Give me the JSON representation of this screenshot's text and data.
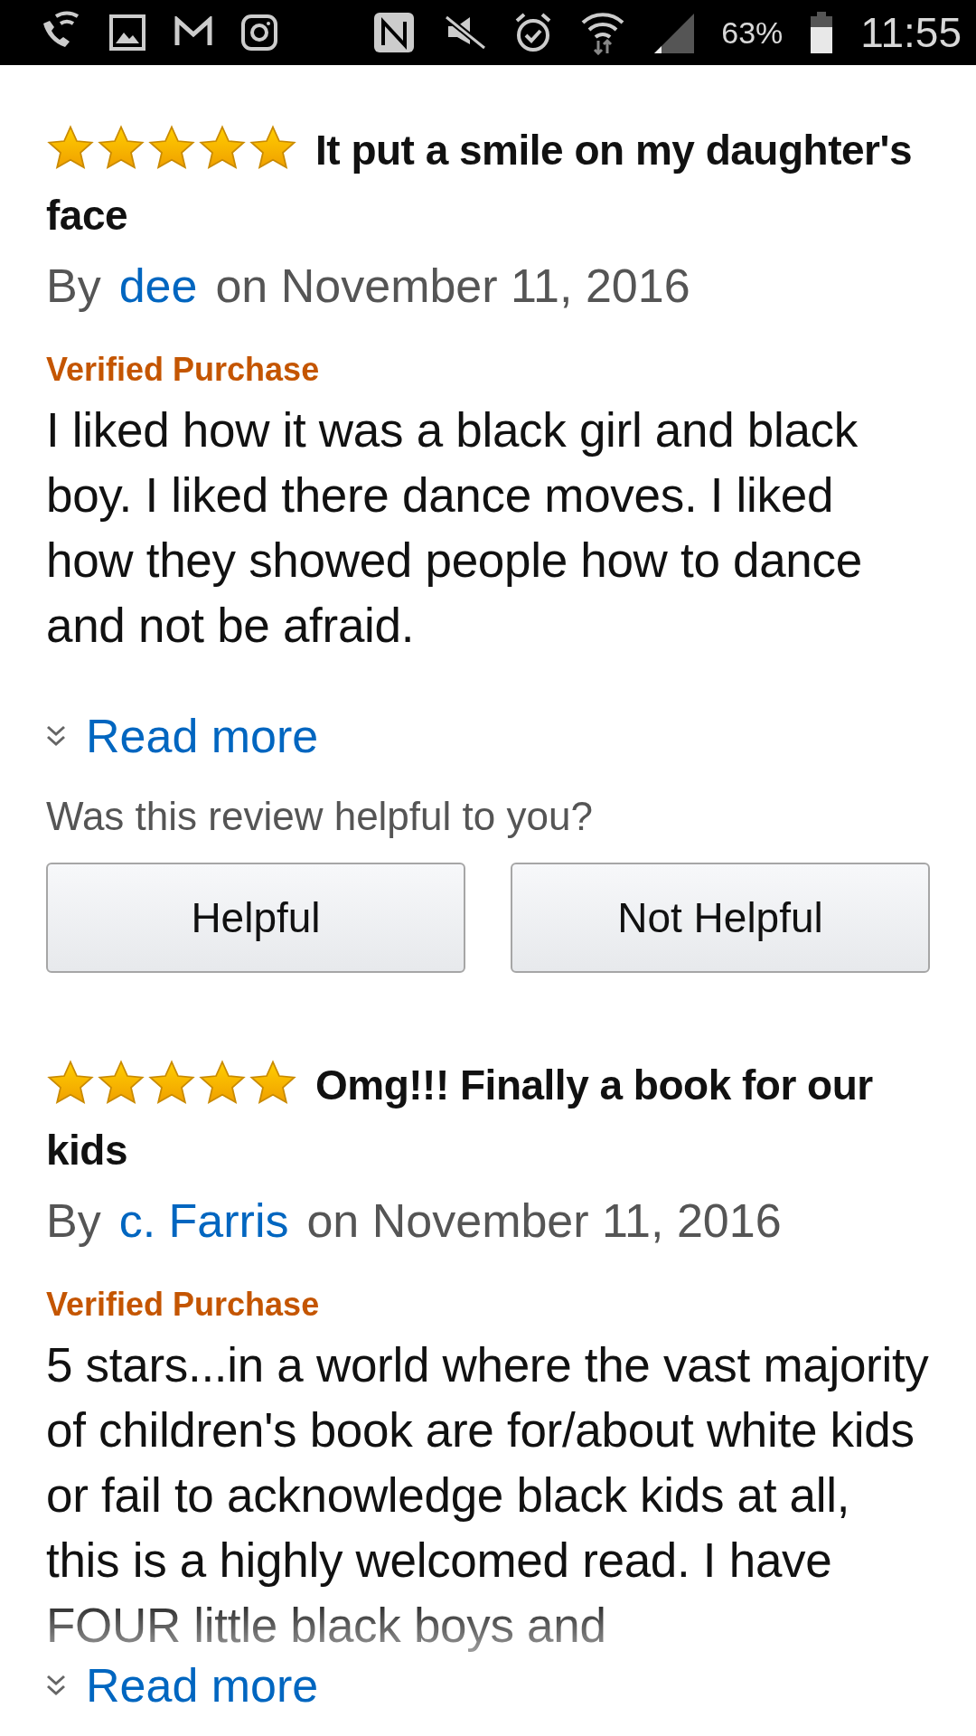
{
  "status_bar": {
    "battery": "63%",
    "time": "11:55"
  },
  "reviews": [
    {
      "stars": 5,
      "title": "It put a smile on my daughter's face",
      "by": "By",
      "author": "dee",
      "date": "on November 11, 2016",
      "badge": "Verified Purchase",
      "body": "I liked how it was a black girl and black boy. I liked there dance moves. I liked how they showed people how to dance and not be afraid.",
      "faded": false,
      "read_more": "Read more",
      "helpful_prompt": "Was this review helpful to you?",
      "buttons": [
        "Helpful",
        "Not Helpful"
      ]
    },
    {
      "stars": 5,
      "title": "Omg!!! Finally a book for our kids",
      "by": "By",
      "author": "c. Farris",
      "date": "on November 11, 2016",
      "badge": "Verified Purchase",
      "body": "5 stars...in a world where the vast majority of children's book are for/about white kids or fail to acknowledge black kids at all, this is a highly welcomed read. I have FOUR little black boys and",
      "faded": true,
      "read_more": "Read more"
    }
  ]
}
